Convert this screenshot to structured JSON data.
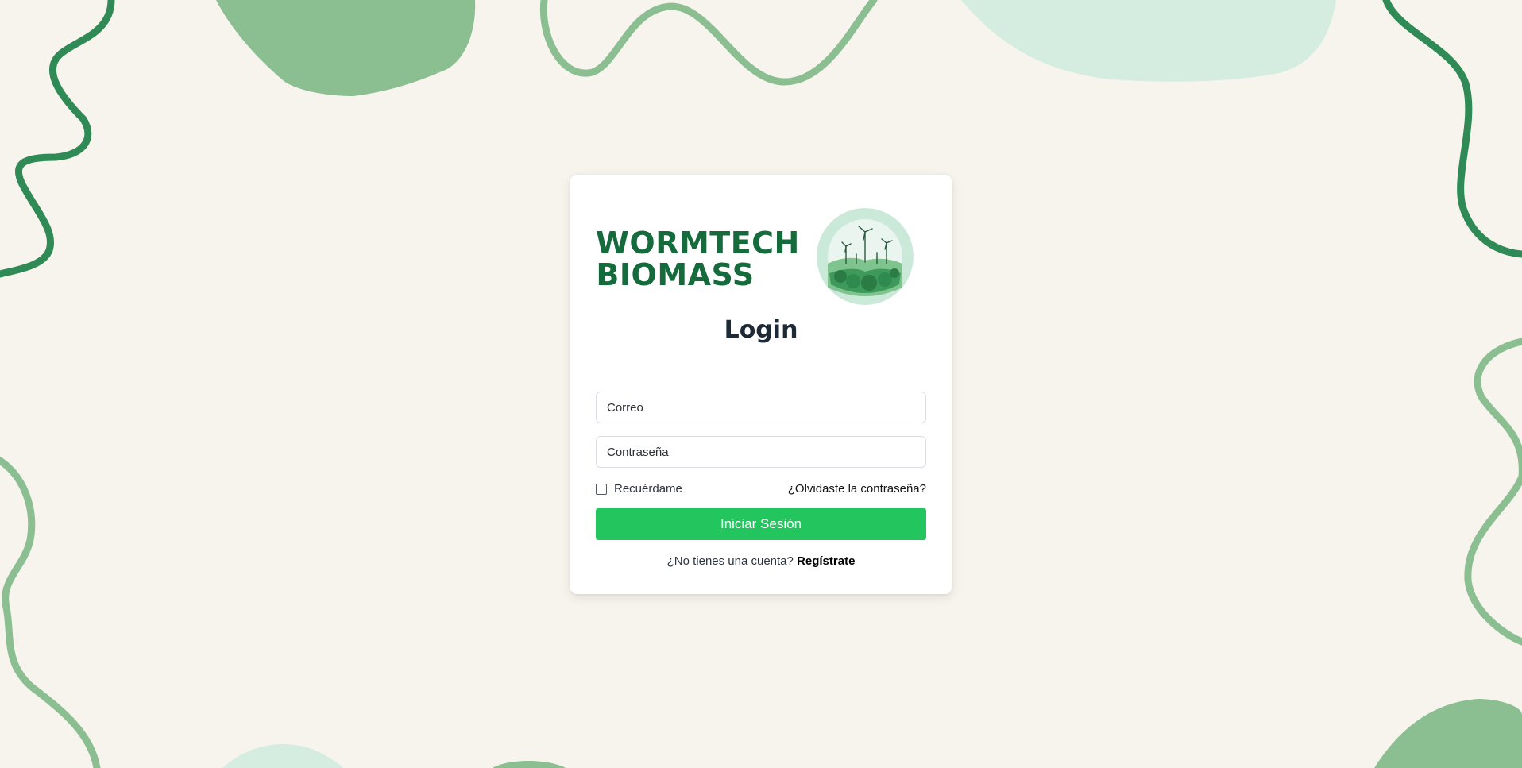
{
  "brand": {
    "line1": "WORMTECH",
    "line2": "BIOMASS",
    "logo_icon": "wind-turbine-landscape-icon",
    "color": "#156b3c"
  },
  "login": {
    "title": "Login",
    "email_placeholder": "Correo",
    "password_placeholder": "Contraseña",
    "remember_label": "Recuérdame",
    "forgot_link": "¿Olvidaste la contraseña?",
    "submit_label": "Iniciar Sesión",
    "register_prompt": "¿No tienes una cuenta?",
    "register_link": "Regístrate"
  },
  "colors": {
    "background": "#f7f4ee",
    "accent": "#22c55e",
    "deco_dark": "#2f8a55",
    "deco_mid": "#8bbf92",
    "deco_light": "#d5ece0"
  }
}
